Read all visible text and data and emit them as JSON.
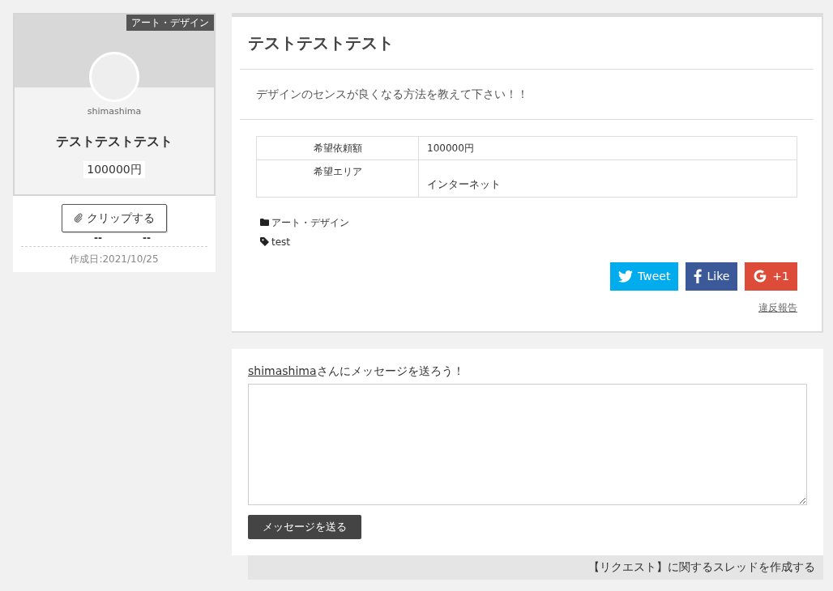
{
  "card": {
    "category_badge": "アート・デザイン",
    "username": "shimashima",
    "title": "テストテストテスト",
    "price": "100000円",
    "clip_button": "クリップする",
    "stats": [
      "--",
      "--"
    ],
    "created": "作成日:2021/10/25"
  },
  "request": {
    "title": "テストテストテスト",
    "description": "デザインのセンスが良くなる方法を教えて下さい！！",
    "table": {
      "rows": [
        {
          "label": "希望依頼額",
          "value": "100000円"
        },
        {
          "label": "希望エリア",
          "value": "インターネット"
        }
      ]
    },
    "category": "アート・デザイン",
    "tag": "test",
    "share_buttons": [
      {
        "kind": "twitter",
        "label": "Tweet"
      },
      {
        "kind": "facebook",
        "label": "Like"
      },
      {
        "kind": "google",
        "label": "+1"
      }
    ],
    "report_link": "違反報告"
  },
  "message": {
    "user_link": "shimashima",
    "prompt": "さんにメッセージを送ろう！",
    "send_button": "メッセージを送る"
  },
  "thread_bar": "【リクエスト】に関するスレッドを作成する"
}
